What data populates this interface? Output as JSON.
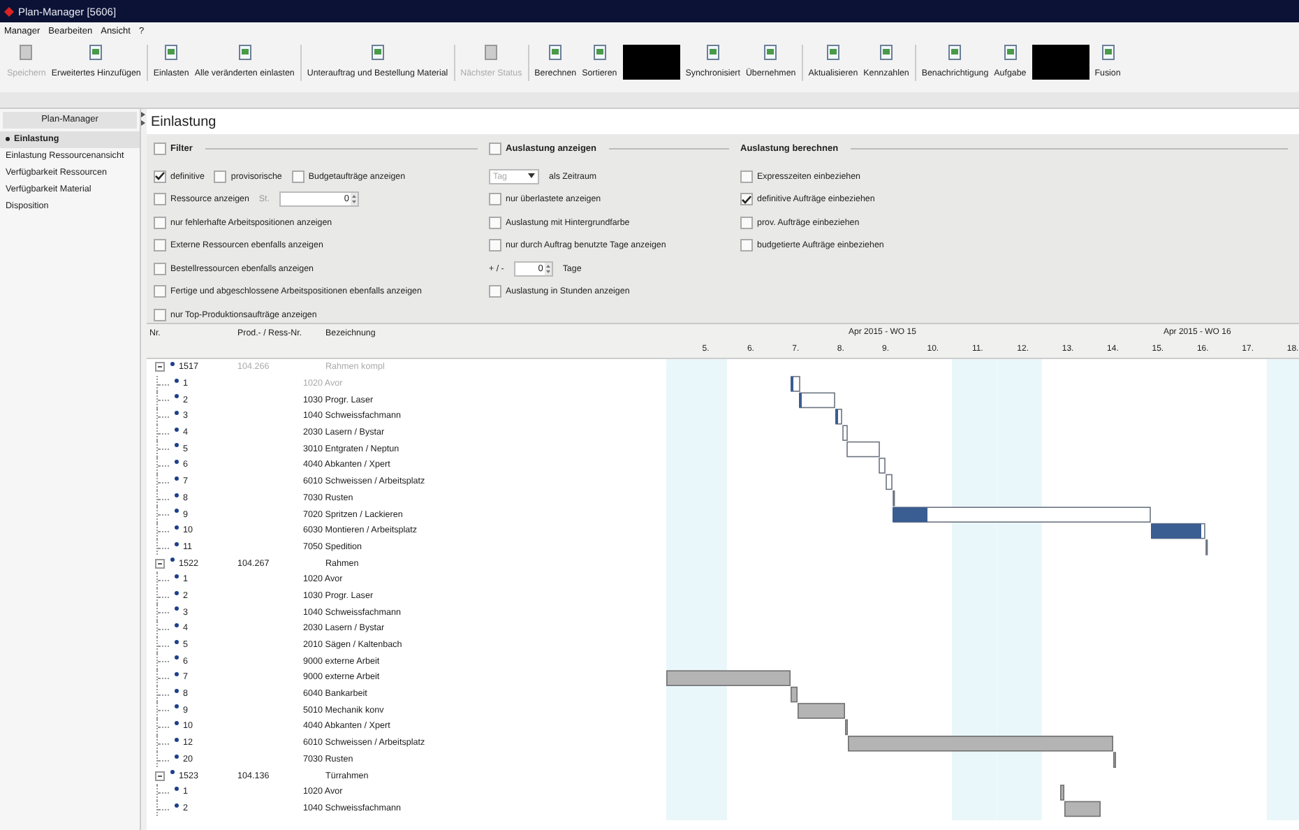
{
  "window": {
    "title": "Plan-Manager [5606]"
  },
  "menu": [
    "Manager",
    "Bearbeiten",
    "Ansicht",
    "?"
  ],
  "toolbar": [
    {
      "kind": "button",
      "label": "Speichern",
      "disabled": true
    },
    {
      "kind": "button",
      "label": "Erweitertes Hinzufügen",
      "disabled": false
    },
    {
      "kind": "separator"
    },
    {
      "kind": "button",
      "label": "Einlasten",
      "disabled": false
    },
    {
      "kind": "button",
      "label": "Alle veränderten einlasten",
      "disabled": false
    },
    {
      "kind": "separator"
    },
    {
      "kind": "button",
      "label": "Unterauftrag und Bestellung Material",
      "disabled": false
    },
    {
      "kind": "separator"
    },
    {
      "kind": "button",
      "label": "Nächster Status",
      "disabled": true
    },
    {
      "kind": "separator"
    },
    {
      "kind": "button",
      "label": "Berechnen",
      "disabled": false
    },
    {
      "kind": "button",
      "label": "Sortieren",
      "disabled": false
    },
    {
      "kind": "blackout"
    },
    {
      "kind": "button",
      "label": "Synchronisiert",
      "disabled": false
    },
    {
      "kind": "button",
      "label": "Übernehmen",
      "disabled": false
    },
    {
      "kind": "separator"
    },
    {
      "kind": "button",
      "label": "Aktualisieren",
      "disabled": false
    },
    {
      "kind": "button",
      "label": "Kennzahlen",
      "disabled": false
    },
    {
      "kind": "separator"
    },
    {
      "kind": "button",
      "label": "Benachrichtigung",
      "disabled": false
    },
    {
      "kind": "button",
      "label": "Aufgabe",
      "disabled": false
    },
    {
      "kind": "blackout"
    },
    {
      "kind": "button",
      "label": "Fusion",
      "disabled": false
    }
  ],
  "sidebar": {
    "title": "Plan-Manager",
    "items": [
      {
        "label": "Einlastung",
        "selected": true
      },
      {
        "label": "Einlastung Ressourcenansicht",
        "selected": false
      },
      {
        "label": "Verfügbarkeit Ressourcen",
        "selected": false
      },
      {
        "label": "Verfügbarkeit Material",
        "selected": false
      },
      {
        "label": "Disposition",
        "selected": false
      }
    ]
  },
  "page": {
    "title": "Einlastung"
  },
  "filter_sections": [
    {
      "title": "Filter",
      "kind": "checkbox",
      "checked": false,
      "rows": [
        [
          {
            "kind": "checkbox",
            "label": "definitive",
            "checked": true
          },
          {
            "kind": "checkbox",
            "label": "provisorische",
            "checked": false
          },
          {
            "kind": "checkbox",
            "label": "Budgetaufträge anzeigen",
            "checked": false
          }
        ],
        [
          {
            "kind": "checkbox",
            "label": "Ressource anzeigen",
            "checked": false
          },
          {
            "kind": "hint",
            "text": "St."
          },
          {
            "kind": "spinner",
            "value": "0"
          }
        ],
        [
          {
            "kind": "checkbox",
            "label": "nur fehlerhafte Arbeitspositionen anzeigen",
            "checked": false
          }
        ],
        [
          {
            "kind": "checkbox",
            "label": "Externe Ressourcen ebenfalls anzeigen",
            "checked": false
          }
        ],
        [
          {
            "kind": "checkbox",
            "label": "Bestellressourcen ebenfalls anzeigen",
            "checked": false
          }
        ],
        [
          {
            "kind": "checkbox",
            "label": "Fertige und abgeschlossene Arbeitspositionen ebenfalls anzeigen",
            "checked": false
          }
        ],
        [
          {
            "kind": "checkbox",
            "label": "nur Top-Produktionsaufträge anzeigen",
            "checked": false
          }
        ]
      ]
    },
    {
      "title": "Auslastung anzeigen",
      "kind": "checkbox",
      "checked": false,
      "rows": [
        [
          {
            "kind": "dropdown",
            "placeholder": "Tag",
            "label": "als Zeitraum"
          }
        ],
        [
          {
            "kind": "checkbox",
            "label": "nur überlastete anzeigen",
            "checked": false
          }
        ],
        [
          {
            "kind": "checkbox",
            "label": "Auslastung mit Hintergrundfarbe",
            "checked": false
          }
        ],
        [
          {
            "kind": "checkbox",
            "label": "nur durch Auftrag benutzte Tage anzeigen",
            "checked": false
          }
        ],
        [
          {
            "kind": "text",
            "text": "+ / -"
          },
          {
            "kind": "spinner",
            "value": "0"
          },
          {
            "kind": "text",
            "text": "Tage"
          }
        ],
        [
          {
            "kind": "checkbox",
            "label": "Auslastung in Stunden anzeigen",
            "checked": false
          }
        ]
      ]
    },
    {
      "title": "Auslastung berechnen",
      "kind": "plain",
      "rows": [
        [
          {
            "kind": "checkbox",
            "label": "Expresszeiten einbeziehen",
            "checked": false
          }
        ],
        [
          {
            "kind": "checkbox",
            "label": "definitive Aufträge einbeziehen",
            "checked": true
          }
        ],
        [
          {
            "kind": "checkbox",
            "label": "prov. Aufträge einbeziehen",
            "checked": false
          }
        ],
        [
          {
            "kind": "checkbox",
            "label": "budgetierte Aufträge einbeziehen",
            "checked": false
          }
        ]
      ]
    }
  ],
  "table": {
    "columns": [
      "Nr.",
      "Prod.- / Ress-Nr.",
      "Bezeichnung"
    ],
    "weeks": [
      "Apr 2015 - WO 15",
      "Apr 2015 - WO 16"
    ],
    "days": [
      {
        "label": "5.",
        "weekend": true
      },
      {
        "label": "6.",
        "weekend": false
      },
      {
        "label": "7.",
        "weekend": false
      },
      {
        "label": "8.",
        "weekend": false
      },
      {
        "label": "9.",
        "weekend": false
      },
      {
        "label": "10.",
        "weekend": false
      },
      {
        "label": "11.",
        "weekend": true
      },
      {
        "label": "12.",
        "weekend": true
      },
      {
        "label": "13.",
        "weekend": false
      },
      {
        "label": "14.",
        "weekend": false
      },
      {
        "label": "15.",
        "weekend": false
      },
      {
        "label": "16.",
        "weekend": false
      },
      {
        "label": "17.",
        "weekend": false
      },
      {
        "label": "18.",
        "weekend": true
      }
    ],
    "orders": [
      {
        "nr": "1517",
        "prod": "104.266",
        "name": "Rahmen kompl",
        "expanded": true,
        "greyed": true,
        "children": [
          {
            "nr": "1",
            "name": "1020 Avor",
            "greyed": true
          },
          {
            "nr": "2",
            "name": "1030 Progr. Laser",
            "greyed": false
          },
          {
            "nr": "3",
            "name": "1040 Schweissfachmann",
            "greyed": false
          },
          {
            "nr": "4",
            "name": "2030 Lasern / Bystar",
            "greyed": false
          },
          {
            "nr": "5",
            "name": "3010 Entgraten / Neptun",
            "greyed": false
          },
          {
            "nr": "6",
            "name": "4040 Abkanten / Xpert",
            "greyed": false
          },
          {
            "nr": "7",
            "name": "6010 Schweissen / Arbeitsplatz",
            "greyed": false
          },
          {
            "nr": "8",
            "name": "7030 Rusten",
            "greyed": false
          },
          {
            "nr": "9",
            "name": "7020 Spritzen / Lackieren",
            "greyed": false
          },
          {
            "nr": "10",
            "name": "6030 Montieren / Arbeitsplatz",
            "greyed": false
          },
          {
            "nr": "11",
            "name": "7050 Spedition",
            "greyed": false
          }
        ]
      },
      {
        "nr": "1522",
        "prod": "104.267",
        "name": "Rahmen",
        "expanded": true,
        "greyed": false,
        "children": [
          {
            "nr": "1",
            "name": "1020 Avor",
            "greyed": false
          },
          {
            "nr": "2",
            "name": "1030 Progr. Laser",
            "greyed": false
          },
          {
            "nr": "3",
            "name": "1040 Schweissfachmann",
            "greyed": false
          },
          {
            "nr": "4",
            "name": "2030 Lasern / Bystar",
            "greyed": false
          },
          {
            "nr": "5",
            "name": "2010 Sägen / Kaltenbach",
            "greyed": false
          },
          {
            "nr": "6",
            "name": "9000 externe Arbeit",
            "greyed": false
          },
          {
            "nr": "7",
            "name": "9000 externe Arbeit",
            "greyed": false
          },
          {
            "nr": "8",
            "name": "6040 Bankarbeit",
            "greyed": false
          },
          {
            "nr": "9",
            "name": "5010 Mechanik konv",
            "greyed": false
          },
          {
            "nr": "10",
            "name": "4040 Abkanten / Xpert",
            "greyed": false
          },
          {
            "nr": "12",
            "name": "6010 Schweissen / Arbeitsplatz",
            "greyed": false
          },
          {
            "nr": "20",
            "name": "7030 Rusten",
            "greyed": false
          }
        ]
      },
      {
        "nr": "1523",
        "prod": "104.136",
        "name": "Türrahmen",
        "expanded": true,
        "greyed": false,
        "children": [
          {
            "nr": "1",
            "name": "1020 Avor",
            "greyed": false
          },
          {
            "nr": "2",
            "name": "1040 Schweissfachmann",
            "greyed": false
          }
        ]
      }
    ]
  }
}
